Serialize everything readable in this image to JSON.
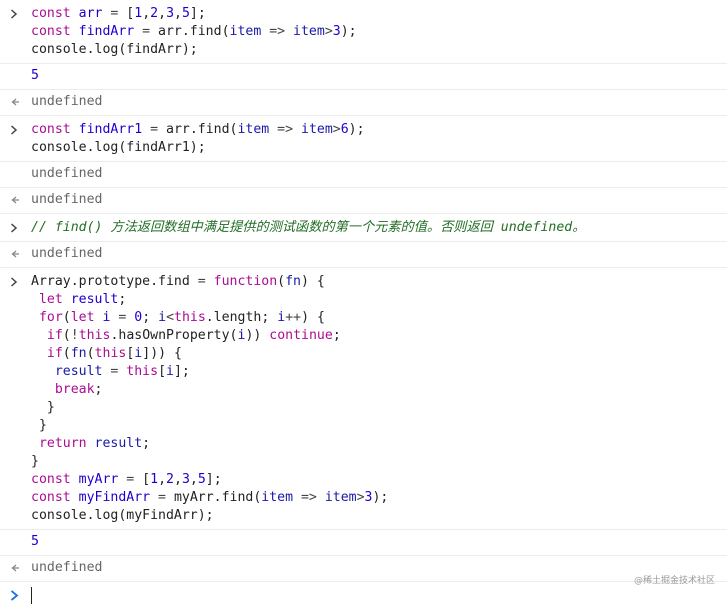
{
  "console": {
    "entries": [
      {
        "kind": "input",
        "lines": [
          [
            [
              "kw",
              "const "
            ],
            [
              "var",
              "arr"
            ],
            [
              "op",
              " = "
            ],
            [
              "punc",
              "["
            ],
            [
              "num",
              "1"
            ],
            [
              "punc",
              ","
            ],
            [
              "num",
              "2"
            ],
            [
              "punc",
              ","
            ],
            [
              "num",
              "3"
            ],
            [
              "punc",
              ","
            ],
            [
              "num",
              "5"
            ],
            [
              "punc",
              "];"
            ]
          ],
          [
            [
              "kw",
              "const "
            ],
            [
              "var",
              "findArr"
            ],
            [
              "op",
              " = "
            ],
            [
              "plain",
              "arr.find("
            ],
            [
              "var2",
              "item"
            ],
            [
              "op",
              " => "
            ],
            [
              "var2",
              "item"
            ],
            [
              "op",
              ">"
            ],
            [
              "num",
              "3"
            ],
            [
              "punc",
              ");"
            ]
          ],
          [
            [
              "plain",
              "console.log(findArr);"
            ]
          ]
        ]
      },
      {
        "kind": "log",
        "text": "5",
        "style": "num"
      },
      {
        "kind": "return",
        "text": "undefined"
      },
      {
        "kind": "input",
        "lines": [
          [
            [
              "kw",
              "const "
            ],
            [
              "var",
              "findArr1"
            ],
            [
              "op",
              " = "
            ],
            [
              "plain",
              "arr.find("
            ],
            [
              "var2",
              "item"
            ],
            [
              "op",
              " => "
            ],
            [
              "var2",
              "item"
            ],
            [
              "op",
              ">"
            ],
            [
              "num",
              "6"
            ],
            [
              "punc",
              ");"
            ]
          ],
          [
            [
              "plain",
              "console.log(findArr1);"
            ]
          ]
        ]
      },
      {
        "kind": "log",
        "text": "undefined",
        "style": "undef"
      },
      {
        "kind": "return",
        "text": "undefined"
      },
      {
        "kind": "input",
        "lines": [
          [
            [
              "com",
              "// find() 方法返回数组中满足提供的测试函数的第一个元素的值。否则返回 undefined。"
            ]
          ]
        ]
      },
      {
        "kind": "return",
        "text": "undefined"
      },
      {
        "kind": "input",
        "lines": [
          [
            [
              "plain",
              "Array.prototype.find"
            ],
            [
              "op",
              " = "
            ],
            [
              "kw",
              "function"
            ],
            [
              "punc",
              "("
            ],
            [
              "var2",
              "fn"
            ],
            [
              "punc",
              ") {"
            ]
          ],
          [
            [
              "plain",
              " "
            ],
            [
              "kw",
              "let "
            ],
            [
              "var",
              "result"
            ],
            [
              "punc",
              ";"
            ]
          ],
          [
            [
              "plain",
              " "
            ],
            [
              "kw",
              "for"
            ],
            [
              "punc",
              "("
            ],
            [
              "kw",
              "let "
            ],
            [
              "var",
              "i"
            ],
            [
              "op",
              " = "
            ],
            [
              "num",
              "0"
            ],
            [
              "punc",
              "; "
            ],
            [
              "var2",
              "i"
            ],
            [
              "op",
              "<"
            ],
            [
              "kw",
              "this"
            ],
            [
              "plain",
              ".length"
            ],
            [
              "punc",
              "; "
            ],
            [
              "var2",
              "i"
            ],
            [
              "op",
              "++"
            ],
            [
              "punc",
              ") {"
            ]
          ],
          [
            [
              "plain",
              "  "
            ],
            [
              "kw",
              "if"
            ],
            [
              "punc",
              "("
            ],
            [
              "op",
              "!"
            ],
            [
              "kw",
              "this"
            ],
            [
              "plain",
              ".hasOwnProperty("
            ],
            [
              "var2",
              "i"
            ],
            [
              "punc",
              "))"
            ],
            [
              "plain",
              " "
            ],
            [
              "kw",
              "continue"
            ],
            [
              "punc",
              ";"
            ]
          ],
          [
            [
              "plain",
              "  "
            ],
            [
              "kw",
              "if"
            ],
            [
              "punc",
              "("
            ],
            [
              "var2",
              "fn"
            ],
            [
              "punc",
              "("
            ],
            [
              "kw",
              "this"
            ],
            [
              "punc",
              "["
            ],
            [
              "var2",
              "i"
            ],
            [
              "punc",
              "])) {"
            ]
          ],
          [
            [
              "plain",
              "   "
            ],
            [
              "var2",
              "result"
            ],
            [
              "op",
              " = "
            ],
            [
              "kw",
              "this"
            ],
            [
              "punc",
              "["
            ],
            [
              "var2",
              "i"
            ],
            [
              "punc",
              "];"
            ]
          ],
          [
            [
              "plain",
              "   "
            ],
            [
              "kw",
              "break"
            ],
            [
              "punc",
              ";"
            ]
          ],
          [
            [
              "plain",
              "  }"
            ]
          ],
          [
            [
              "plain",
              " }"
            ]
          ],
          [
            [
              "plain",
              " "
            ],
            [
              "kw",
              "return "
            ],
            [
              "var2",
              "result"
            ],
            [
              "punc",
              ";"
            ]
          ],
          [
            [
              "plain",
              "}"
            ]
          ],
          [
            [
              "kw",
              "const "
            ],
            [
              "var",
              "myArr"
            ],
            [
              "op",
              " = "
            ],
            [
              "punc",
              "["
            ],
            [
              "num",
              "1"
            ],
            [
              "punc",
              ","
            ],
            [
              "num",
              "2"
            ],
            [
              "punc",
              ","
            ],
            [
              "num",
              "3"
            ],
            [
              "punc",
              ","
            ],
            [
              "num",
              "5"
            ],
            [
              "punc",
              "];"
            ]
          ],
          [
            [
              "kw",
              "const "
            ],
            [
              "var",
              "myFindArr"
            ],
            [
              "op",
              " = "
            ],
            [
              "plain",
              "myArr.find("
            ],
            [
              "var2",
              "item"
            ],
            [
              "op",
              " => "
            ],
            [
              "var2",
              "item"
            ],
            [
              "op",
              ">"
            ],
            [
              "num",
              "3"
            ],
            [
              "punc",
              ");"
            ]
          ],
          [
            [
              "plain",
              "console.log(myFindArr);"
            ]
          ]
        ]
      },
      {
        "kind": "log",
        "text": "5",
        "style": "num"
      },
      {
        "kind": "return",
        "text": "undefined"
      }
    ],
    "prompt": {
      "value": ""
    },
    "icons": {
      "input": "chevron-right-icon",
      "return": "return-arrow-icon",
      "prompt": "prompt-chevron-icon"
    },
    "colors": {
      "keyword": "#aa0d91",
      "variable": "#1c00cf",
      "number": "#1c00cf",
      "comment": "#236e25",
      "prompt": "#1a73e8"
    }
  },
  "watermark": "@稀土掘金技术社区"
}
